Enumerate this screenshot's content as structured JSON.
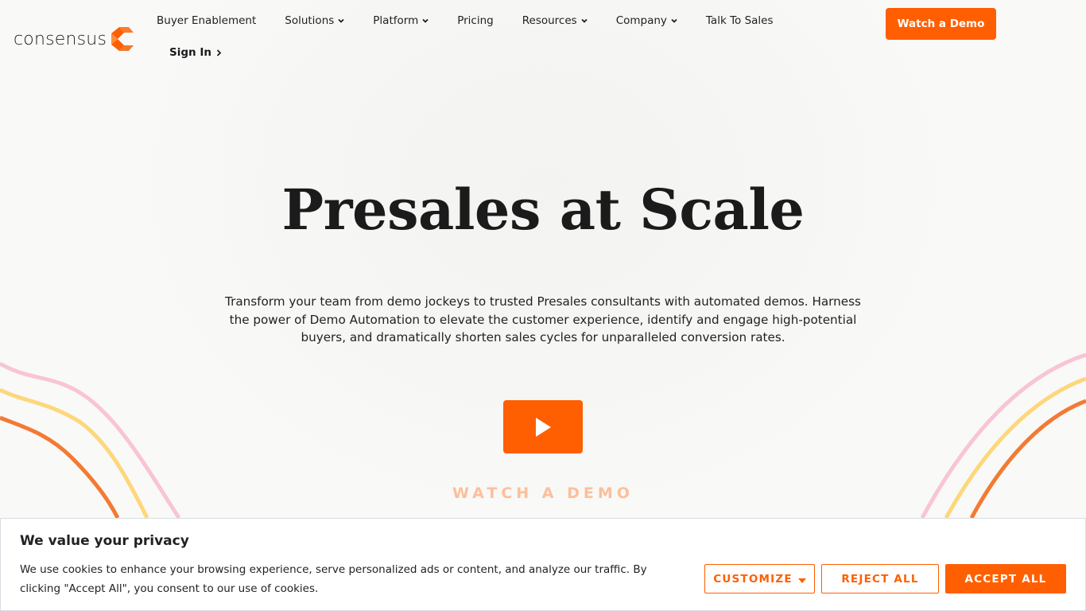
{
  "brand": {
    "name": "consensus",
    "accent": "#ff5f00"
  },
  "nav": {
    "items": [
      {
        "label": "Buyer Enablement",
        "dropdown": false
      },
      {
        "label": "Solutions",
        "dropdown": true
      },
      {
        "label": "Platform",
        "dropdown": true
      },
      {
        "label": "Pricing",
        "dropdown": false
      },
      {
        "label": "Resources",
        "dropdown": true
      },
      {
        "label": "Company",
        "dropdown": true
      },
      {
        "label": "Talk To Sales",
        "dropdown": false
      }
    ],
    "sign_in": "Sign In",
    "cta": "Watch a Demo"
  },
  "hero": {
    "title": "Presales at Scale",
    "subtitle": "Transform your team from demo jockeys to trusted Presales consultants with automated demos. Harness the power of Demo Automation to elevate the customer experience, identify and engage high-potential buyers, and dramatically shorten sales cycles for unparalleled conversion rates.",
    "play_icon": "play-icon",
    "watch_label": "WATCH A DEMO"
  },
  "decor": {
    "wave_colors": [
      "#f9c4d6",
      "#fdd77a",
      "#f47a33"
    ]
  },
  "cookie_banner": {
    "title": "We value your privacy",
    "text": "We use cookies to enhance your browsing experience, serve personalized ads or content, and analyze our traffic. By clicking \"Accept All\", you consent to our use of cookies.",
    "customize": "CUSTOMIZE",
    "reject": "REJECT ALL",
    "accept": "ACCEPT ALL"
  }
}
